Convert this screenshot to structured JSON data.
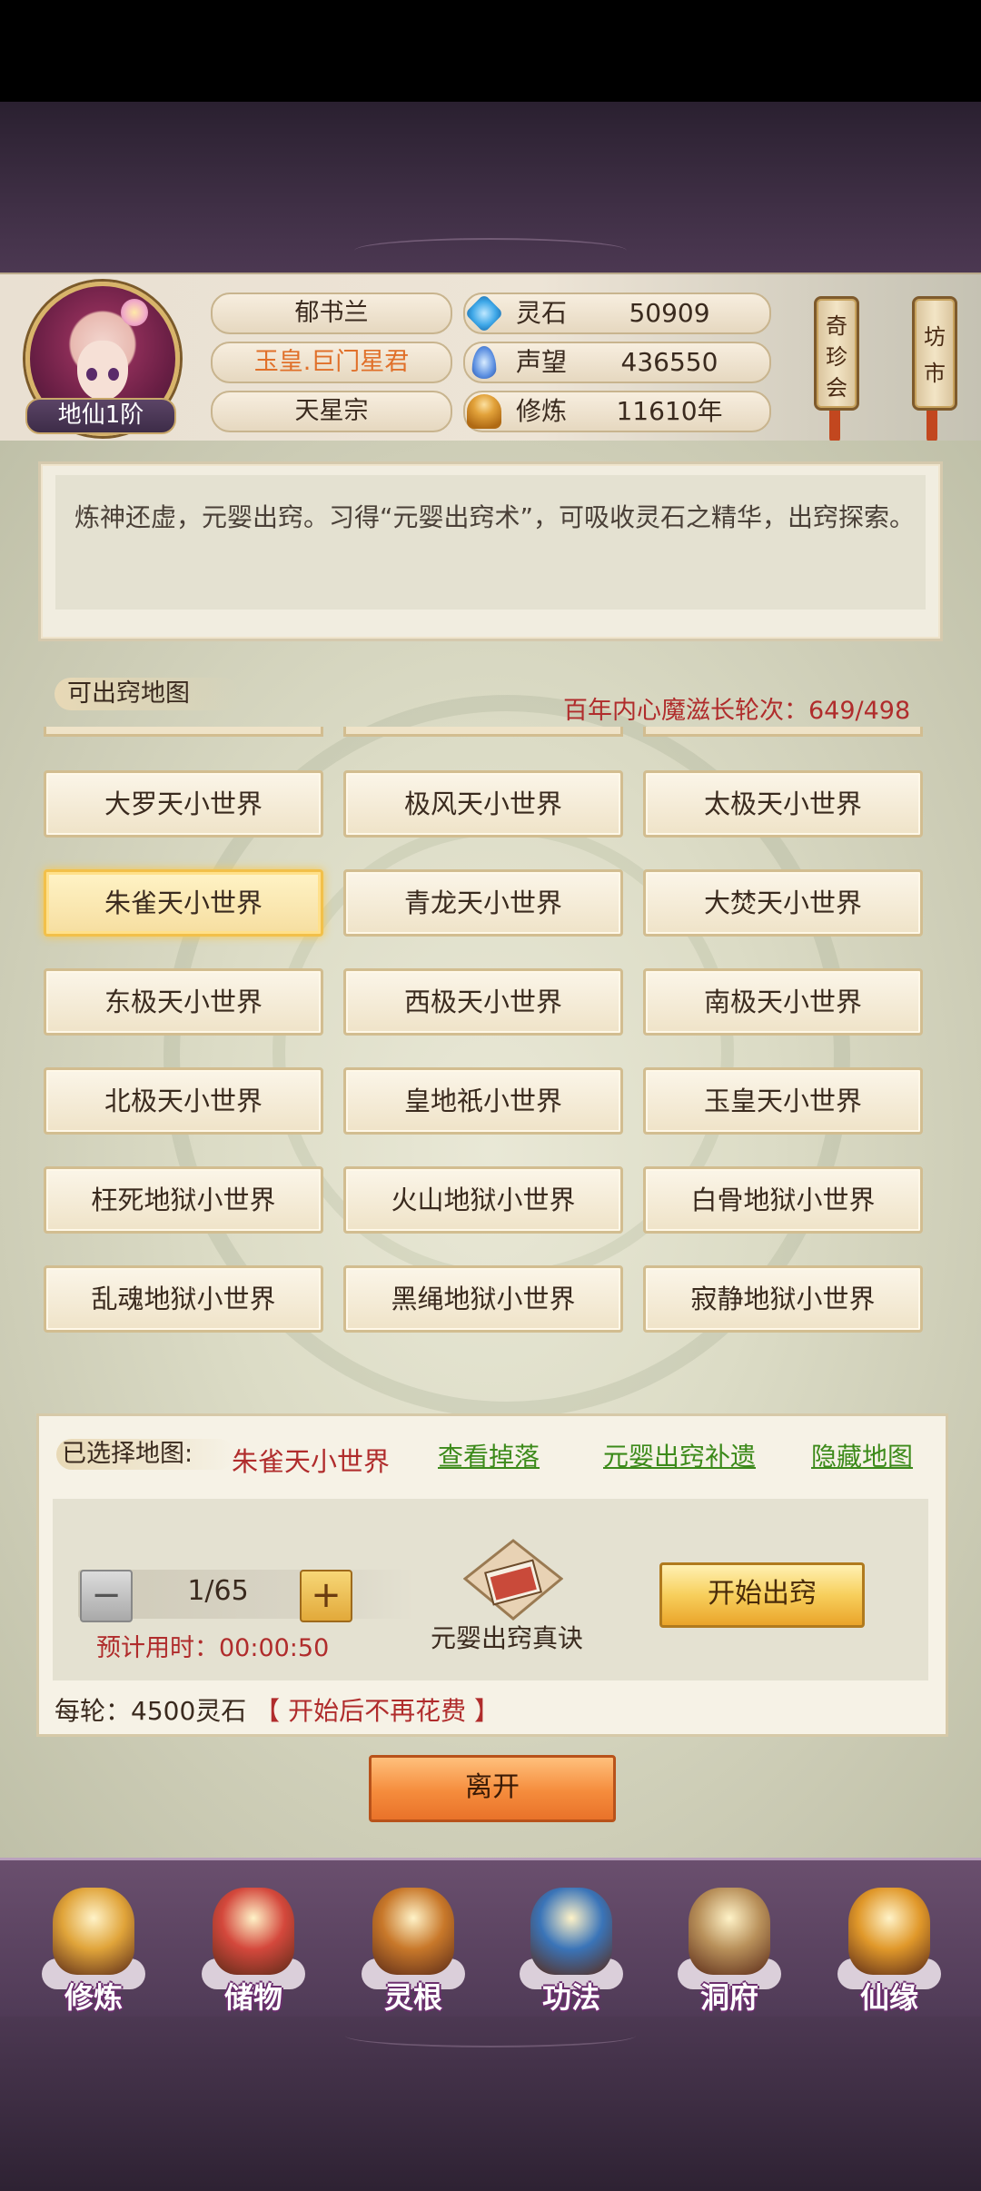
{
  "player": {
    "name": "郁书兰",
    "title": "玉皇.巨门星君",
    "sect": "天星宗",
    "rank": "地仙1阶"
  },
  "stats": [
    {
      "label": "灵石",
      "value": "50909",
      "icon": "spirit-stone-icon",
      "color": "#3fa8e8"
    },
    {
      "label": "声望",
      "value": "436550",
      "icon": "prestige-crystal-icon",
      "color": "#5a8ee0"
    },
    {
      "label": "修炼",
      "value": "11610年",
      "icon": "meditation-icon",
      "color": "#e2a23a"
    }
  ],
  "side_buttons": [
    {
      "label": "奇珍会",
      "chars": [
        "奇",
        "珍",
        "会"
      ]
    },
    {
      "label": "坊市",
      "chars": [
        "坊",
        "市"
      ]
    }
  ],
  "description": "炼神还虚，元婴出窍。习得“元婴出窍术”，可吸收灵石之精华，出窍探索。",
  "maps_section": {
    "label": "可出窍地图",
    "demon_growth_label": "百年内心魔滋长轮次：",
    "demon_growth_value": "649/498",
    "selected_index": 3,
    "maps": [
      "大罗天小世界",
      "极风天小世界",
      "太极天小世界",
      "朱雀天小世界",
      "青龙天小世界",
      "大焚天小世界",
      "东极天小世界",
      "西极天小世界",
      "南极天小世界",
      "北极天小世界",
      "皇地祇小世界",
      "玉皇天小世界",
      "枉死地狱小世界",
      "火山地狱小世界",
      "白骨地狱小世界",
      "乱魂地狱小世界",
      "黑绳地狱小世界",
      "寂静地狱小世界"
    ]
  },
  "selection": {
    "label": "已选择地图:",
    "selected_map": "朱雀天小世界",
    "links": [
      "查看掉落",
      "元婴出窍补遗",
      "隐藏地图"
    ],
    "stepper_value": "1/65",
    "minus_symbol": "−",
    "plus_symbol": "+",
    "eta": "预计用时：00:00:50",
    "book_label": "元婴出窍真诀",
    "start_button": "开始出窍",
    "cost_prefix": "每轮：4500灵石",
    "cost_note": "【 开始后不再花费 】"
  },
  "leave_button": "离开",
  "nav": [
    {
      "label": "修炼",
      "icon": "cultivation-monk-icon",
      "color": "#e0a43a"
    },
    {
      "label": "储物",
      "icon": "storage-bag-icon",
      "color": "#d4483c"
    },
    {
      "label": "灵根",
      "icon": "spirit-root-icon",
      "color": "#c8782a"
    },
    {
      "label": "功法",
      "icon": "technique-book-icon",
      "color": "#3a74b8"
    },
    {
      "label": "洞府",
      "icon": "cave-house-icon",
      "color": "#b8905a"
    },
    {
      "label": "仙缘",
      "icon": "immortal-gourd-icon",
      "color": "#e0982a"
    }
  ]
}
